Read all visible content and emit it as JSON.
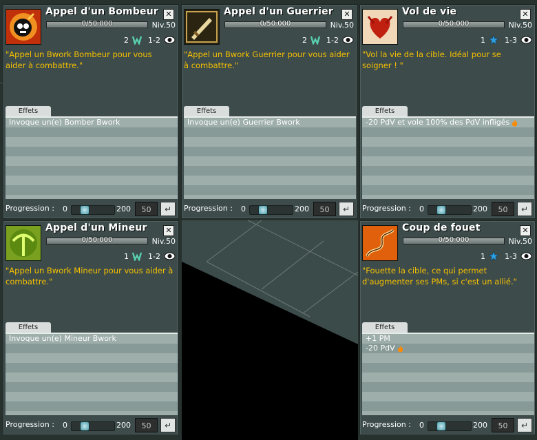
{
  "colors": {
    "accent_yellow": "#f6c000",
    "panel_bg": "#3d4c4b",
    "effects_bg": "#9daeab",
    "floor": "#3a4c4a",
    "void": "#000000"
  },
  "panels": [
    {
      "title": "Appel d'un Bombeur",
      "xp": "0/50 000",
      "level": "Niv.50",
      "cost": "2",
      "cost_icon": "wakfu-w-icon",
      "range": "1-2",
      "description": "\"Appel un Bwork Bombeur pour vous aider à combattre.\"",
      "tab": "Effets",
      "effects": [
        {
          "text": "Invoque un(e) Bomber Bwork",
          "flame": false
        }
      ],
      "progress_label": "Progression :",
      "min": "0",
      "max": "200",
      "value": "50"
    },
    {
      "title": "Appel d'un Guerrier",
      "xp": "0/50 000",
      "level": "Niv.50",
      "cost": "2",
      "cost_icon": "wakfu-w-icon",
      "range": "1-2",
      "description": "\"Appel un Bwork Guerrier pour vous aider à combattre.\"",
      "tab": "Effets",
      "effects": [
        {
          "text": "Invoque un(e) Guerrier Bwork",
          "flame": false
        }
      ],
      "progress_label": "Progression :",
      "min": "0",
      "max": "200",
      "value": "50"
    },
    {
      "title": "Vol de vie",
      "xp": "0/50 000",
      "level": "Niv.50",
      "cost": "1",
      "cost_icon": "star-icon",
      "range": "1-3",
      "description": "\"Vol la vie de la cible. Idéal pour se soigner ! \"",
      "tab": "Effets",
      "effects": [
        {
          "text": "-20 PdV et vole 100% des PdV infligés",
          "flame": true
        }
      ],
      "progress_label": "Progression :",
      "min": "0",
      "max": "200",
      "value": "50"
    },
    {
      "title": "Appel d'un Mineur",
      "xp": "0/50 000",
      "level": "Niv.50",
      "cost": "1",
      "cost_icon": "wakfu-w-icon",
      "range": "1-2",
      "description": "\"Appel un Bwork Mineur pour vous aider à combattre.\"",
      "tab": "Effets",
      "effects": [
        {
          "text": "Invoque un(e) Mineur Bwork",
          "flame": false
        }
      ],
      "progress_label": "Progression :",
      "min": "0",
      "max": "200",
      "value": "50"
    },
    {
      "title": "Coup de fouet",
      "xp": "0/50 000",
      "level": "Niv.50",
      "cost": "1",
      "cost_icon": "star-icon",
      "range": "1-3",
      "description": "\"Fouette la cible, ce qui permet d'augmenter ses PMs, si c'est un allié.\"",
      "tab": "Effets",
      "effects": [
        {
          "text": "+1 PM",
          "flame": false
        },
        {
          "text": "-20 PdV",
          "flame": true
        }
      ],
      "progress_label": "Progression :",
      "min": "0",
      "max": "200",
      "value": "50"
    }
  ]
}
